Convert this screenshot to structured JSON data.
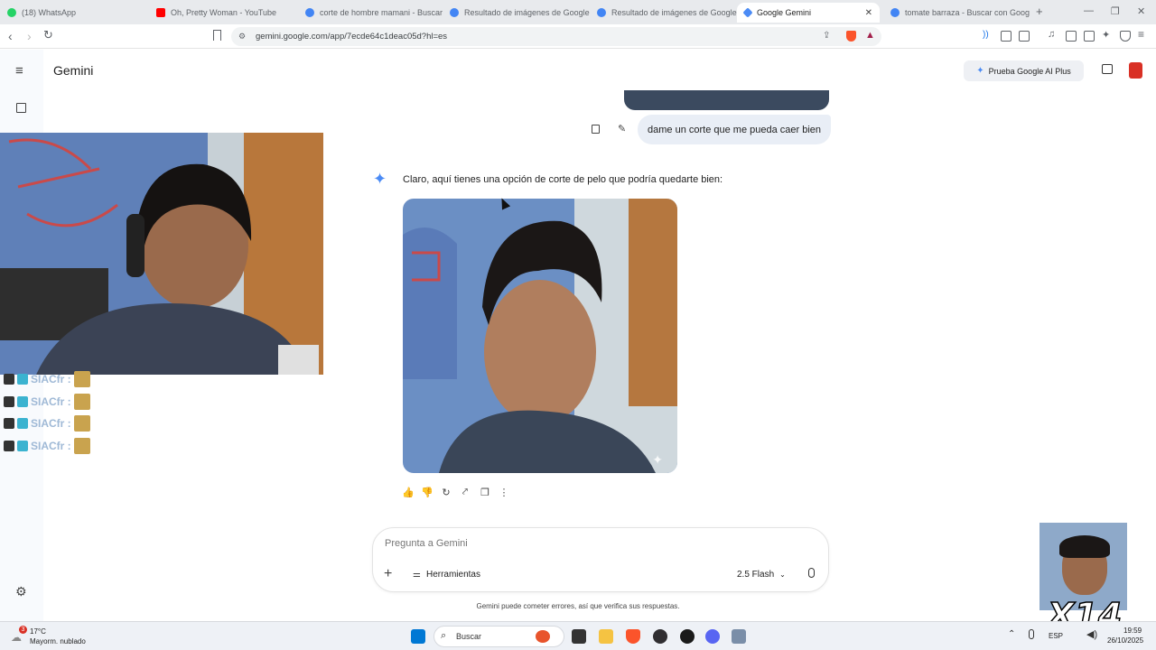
{
  "browser": {
    "tabs": [
      {
        "label": "(18) WhatsApp",
        "favicon_color": "#25d366",
        "active": false
      },
      {
        "label": "Oh, Pretty Woman - YouTube",
        "favicon_color": "#ff0000",
        "active": false
      },
      {
        "label": "corte de hombre mamani - Buscar c",
        "favicon_color": "#4285f4",
        "active": false
      },
      {
        "label": "Resultado de imágenes de Google",
        "favicon_color": "#4285f4",
        "active": false
      },
      {
        "label": "Resultado de imágenes de Google",
        "favicon_color": "#4285f4",
        "active": false
      },
      {
        "label": "Google Gemini",
        "favicon_color": "#4b8bf5",
        "active": true
      },
      {
        "label": "tomate barraza - Buscar con Google",
        "favicon_color": "#4285f4",
        "active": false
      }
    ],
    "url": "gemini.google.com/app/7ecde64c1deac05d?hl=es"
  },
  "app": {
    "name": "Gemini",
    "upgrade_button": "Prueba Google AI Plus"
  },
  "conversation": {
    "user_message": "dame un corte que me pueda caer bien",
    "assistant_reply": "Claro, aquí tienes una opción de corte de pelo que podría quedarte bien:"
  },
  "input": {
    "placeholder": "Pregunta a Gemini",
    "tools_label": "Herramientas",
    "model_label": "2.5 Flash"
  },
  "disclaimer": "Gemini puede cometer errores, así que verifica sus respuestas.",
  "overlay": {
    "chat_lines": [
      "SIACfr :",
      "SIACfr :",
      "SIACfr :",
      "SIACfr :"
    ],
    "multiplier": "X14"
  },
  "taskbar": {
    "weather_temp": "17°C",
    "weather_desc": "Mayorm. nublado",
    "weather_badge": "3",
    "search_label": "Buscar",
    "language": "ESP",
    "time": "19:59",
    "date": "26/10/2025"
  },
  "colors": {
    "gemini_blue": "#4b8bf5",
    "bubble": "#e9eef6",
    "accent_red": "#d93025"
  }
}
